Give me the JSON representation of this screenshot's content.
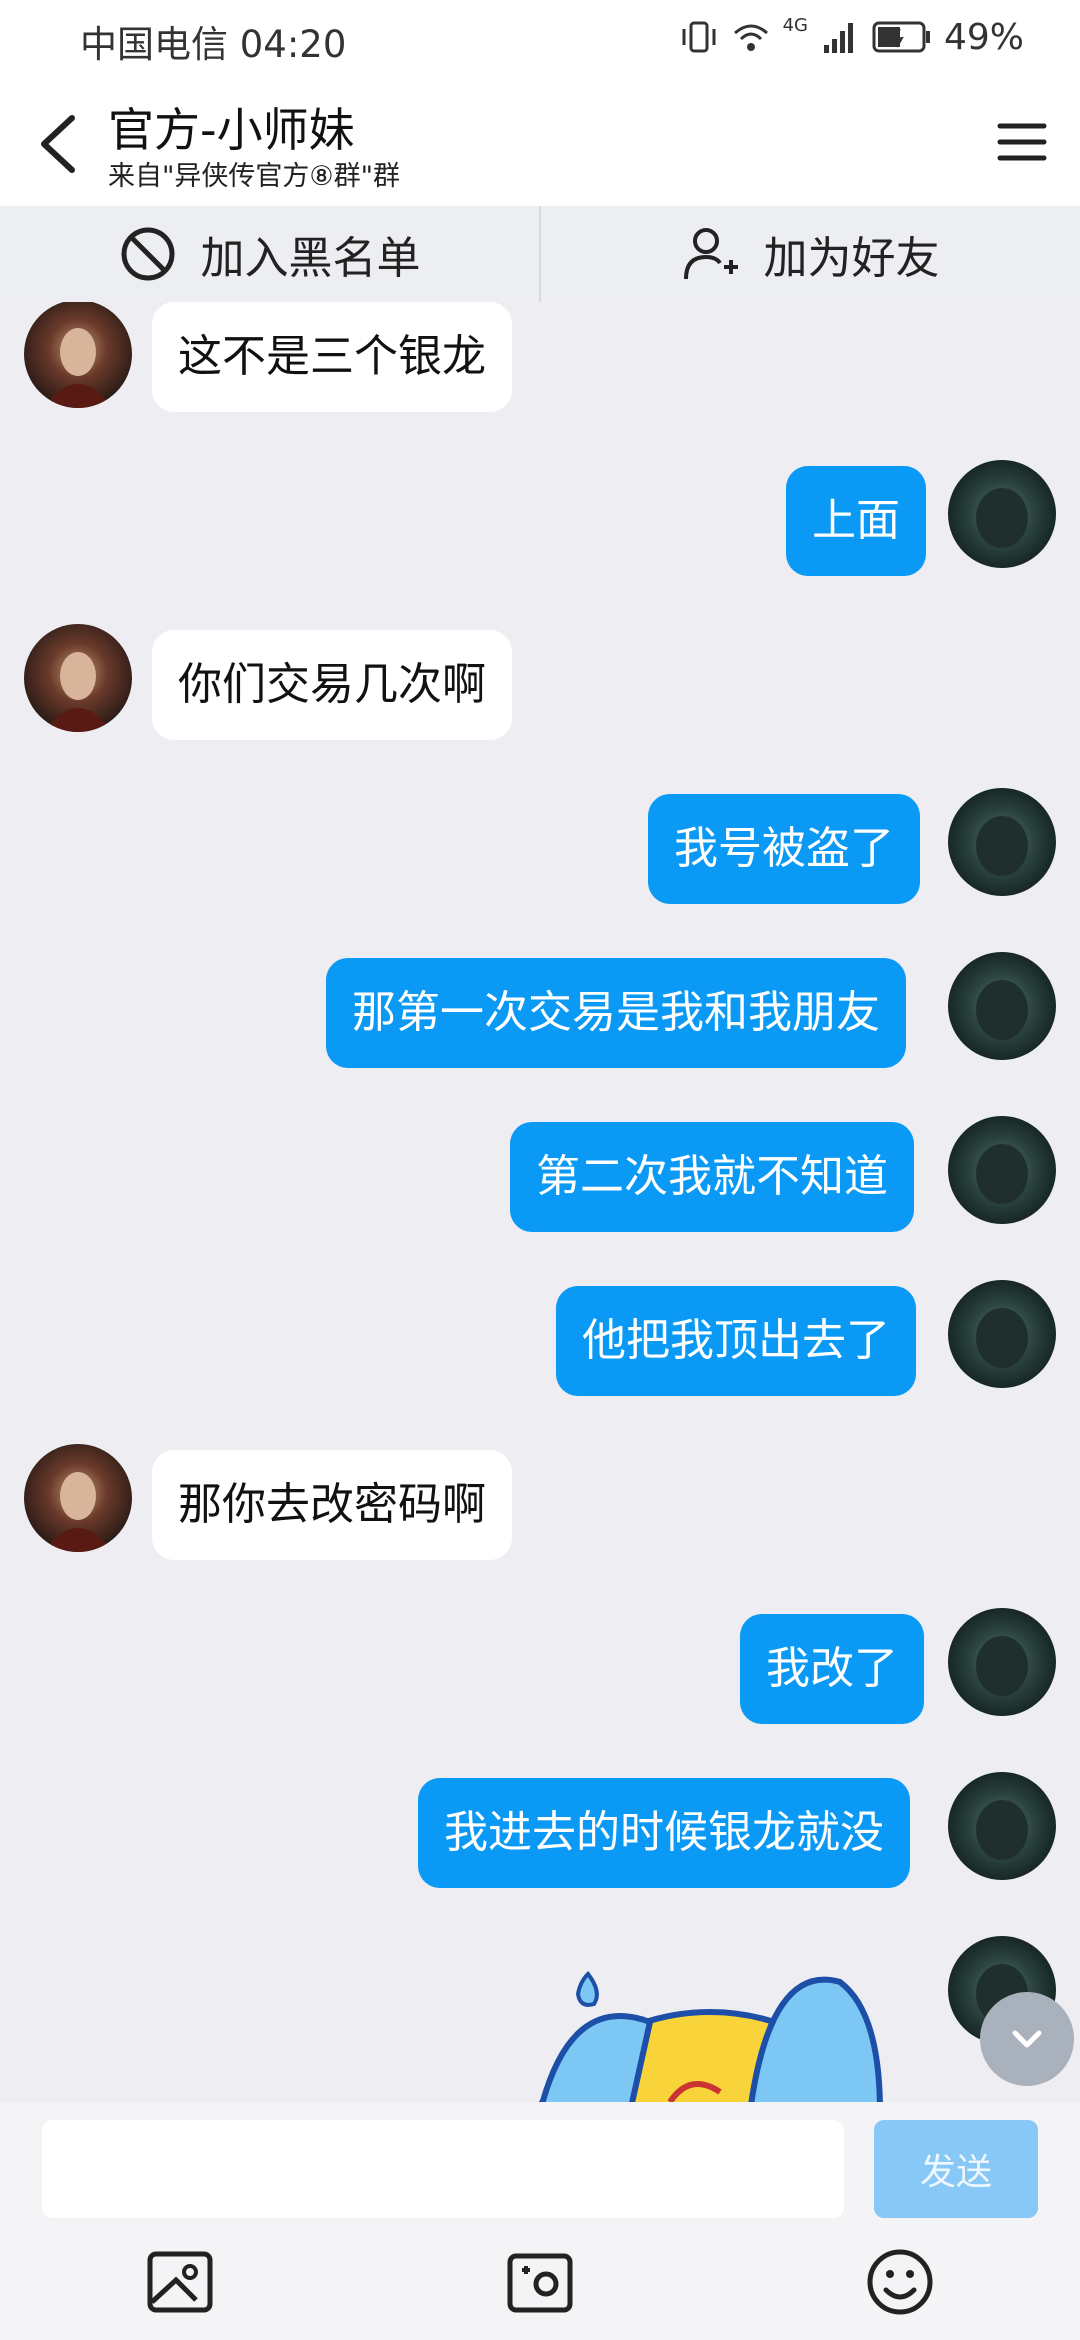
{
  "status_bar": {
    "carrier_time": "中国电信 04:20",
    "network": "4G",
    "battery": "49%"
  },
  "header": {
    "title": "官方-小师妹",
    "subtitle": "来自\"异侠传官方⑧群\"群"
  },
  "actions": {
    "blacklist_label": "加入黑名单",
    "add_friend_label": "加为好友"
  },
  "messages": [
    {
      "side": "left",
      "text": "这不是三个银龙"
    },
    {
      "side": "right",
      "text": "上面"
    },
    {
      "side": "left",
      "text": "你们交易几次啊"
    },
    {
      "side": "right",
      "text": "我号被盗了"
    },
    {
      "side": "right",
      "text": "那第一次交易是我和我朋友"
    },
    {
      "side": "right",
      "text": "第二次我就不知道"
    },
    {
      "side": "right",
      "text": "他把我顶出去了"
    },
    {
      "side": "left",
      "text": "那你去改密码啊"
    },
    {
      "side": "right",
      "text": "我改了"
    },
    {
      "side": "right",
      "text": "我进去的时候银龙就没"
    },
    {
      "side": "right",
      "sticker": "crying-emoji-sticker"
    }
  ],
  "input": {
    "placeholder": "",
    "send_label": "发送"
  },
  "toolbar": {
    "icons": [
      "image-icon",
      "camera-icon",
      "emoji-icon"
    ]
  },
  "colors": {
    "accent": "#0a99f4",
    "bubble_left": "#ffffff",
    "background": "#ededf2"
  }
}
